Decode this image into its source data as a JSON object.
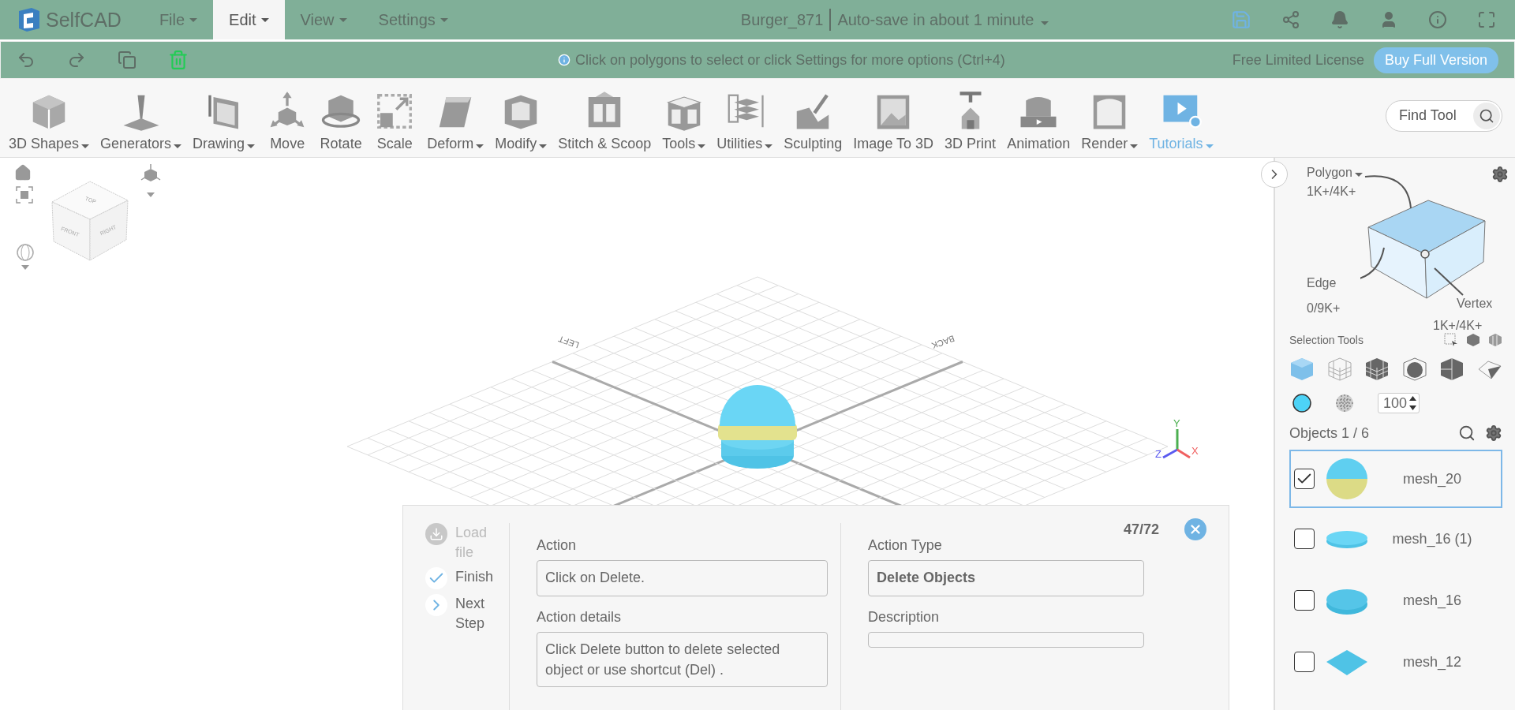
{
  "menubar": {
    "logo": "SelfCAD",
    "menus": [
      {
        "label": "File",
        "selected": false
      },
      {
        "label": "Edit",
        "selected": true
      },
      {
        "label": "View",
        "selected": false
      },
      {
        "label": "Settings",
        "selected": false
      }
    ],
    "project": "Burger_871",
    "autosave": "Auto-save in about 1 minute"
  },
  "actionbar": {
    "hint": "Click on polygons to select or click Settings for more options (Ctrl+4)",
    "license": "Free Limited License",
    "buy": "Buy Full Version"
  },
  "tools": [
    {
      "label": "3D Shapes",
      "dropdown": true,
      "kind": "tool"
    },
    {
      "label": "Generators",
      "dropdown": true,
      "kind": "tool"
    },
    {
      "label": "Drawing",
      "dropdown": true,
      "kind": "tool"
    },
    {
      "label": "Move",
      "dropdown": false,
      "kind": "tool"
    },
    {
      "label": "Rotate",
      "dropdown": false,
      "kind": "tool"
    },
    {
      "label": "Scale",
      "dropdown": false,
      "kind": "tool"
    },
    {
      "label": "Deform",
      "dropdown": true,
      "kind": "tool"
    },
    {
      "label": "Modify",
      "dropdown": true,
      "kind": "tool"
    },
    {
      "label": "Stitch & Scoop",
      "dropdown": false,
      "kind": "tool"
    },
    {
      "label": "Tools",
      "dropdown": true,
      "kind": "tool"
    },
    {
      "label": "Utilities",
      "dropdown": true,
      "kind": "tool"
    },
    {
      "label": "Sculpting",
      "dropdown": false,
      "kind": "tool"
    },
    {
      "label": "Image To 3D",
      "dropdown": false,
      "kind": "tool"
    },
    {
      "label": "3D Print",
      "dropdown": false,
      "kind": "tool"
    },
    {
      "label": "Animation",
      "dropdown": false,
      "kind": "tool"
    },
    {
      "label": "Render",
      "dropdown": true,
      "kind": "tool"
    },
    {
      "label": "Tutorials",
      "dropdown": true,
      "kind": "link"
    }
  ],
  "find_tool": {
    "placeholder": "Find Tool"
  },
  "view_cube": {
    "faces": [
      "TOP",
      "FRONT",
      "RIGHT"
    ]
  },
  "scene": {
    "grid_labels": [
      "LEFT",
      "BACK"
    ],
    "axes": [
      {
        "label": "Y",
        "color": "#4caf50"
      },
      {
        "label": "Z",
        "color": "#5b5bf0"
      },
      {
        "label": "X",
        "color": "#f06060"
      }
    ]
  },
  "panel": {
    "mode": "Polygon",
    "mode_count": "1K+/4K+",
    "edge": "Edge",
    "edge_count": "0/9K+",
    "vertex": "Vertex",
    "vertex_count": "1K+/4K+",
    "selection_tools": "Selection Tools",
    "opacity": "100",
    "objects_heading": "Objects 1 / 6",
    "objects": [
      {
        "name": "mesh_20",
        "checked": true,
        "selected": true,
        "kind": "sphere"
      },
      {
        "name": "mesh_16 (1)",
        "checked": false,
        "selected": false,
        "kind": "flat"
      },
      {
        "name": "mesh_16",
        "checked": false,
        "selected": false,
        "kind": "disc"
      },
      {
        "name": "mesh_12",
        "checked": false,
        "selected": false,
        "kind": "diamond"
      }
    ]
  },
  "dialog": {
    "steps": [
      {
        "label": "Load file",
        "disabled": true,
        "kind": "load"
      },
      {
        "label": "Finish",
        "disabled": false,
        "kind": "finish"
      },
      {
        "label": "Next Step",
        "disabled": false,
        "kind": "next"
      }
    ],
    "counter": "47/72",
    "action_label": "Action",
    "action": "Click on Delete.",
    "details_label": "Action details",
    "details": "Click Delete button to delete selected object or use shortcut  (Del) .",
    "type_label": "Action Type",
    "type": "Delete Objects",
    "description_label": "Description"
  }
}
